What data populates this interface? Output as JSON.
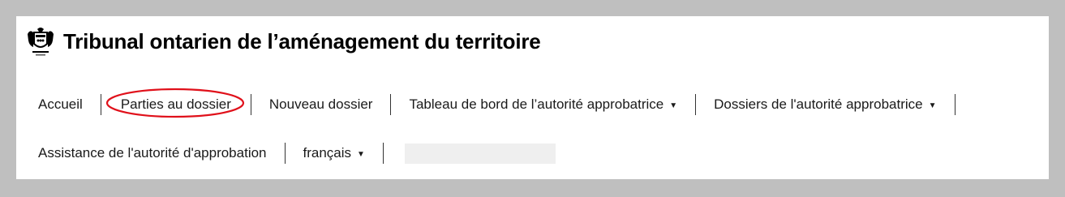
{
  "header": {
    "title": "Tribunal ontarien de l’aménagement du territoire",
    "logo_icon": "ontario-coat-of-arms-icon"
  },
  "nav": {
    "row1": [
      {
        "label": "Accueil",
        "dropdown": false
      },
      {
        "label": "Parties au dossier",
        "dropdown": false,
        "highlighted": true
      },
      {
        "label": "Nouveau dossier",
        "dropdown": false
      },
      {
        "label": "Tableau de bord de l’autorité approbatrice",
        "dropdown": true
      },
      {
        "label": "Dossiers de l'autorité approbatrice",
        "dropdown": true
      }
    ],
    "row2": [
      {
        "label": "Assistance de l'autorité d'approbation",
        "dropdown": false
      },
      {
        "label": "français",
        "dropdown": true
      }
    ],
    "caret_glyph": "▼"
  },
  "colors": {
    "highlight": "#e0101a",
    "background": "#bfbfbf",
    "panel": "#ffffff"
  }
}
